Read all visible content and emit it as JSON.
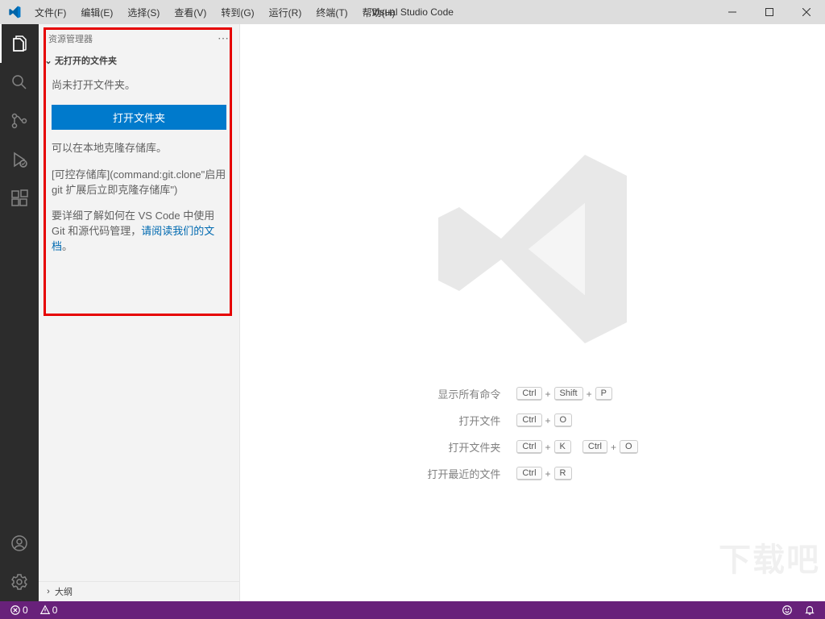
{
  "titlebar": {
    "title": "Visual Studio Code"
  },
  "menu": {
    "file": "文件(F)",
    "edit": "编辑(E)",
    "select": "选择(S)",
    "view": "查看(V)",
    "go": "转到(G)",
    "run": "运行(R)",
    "terminal": "终端(T)",
    "help": "帮助(H)"
  },
  "sidebar": {
    "header": "资源管理器",
    "no_folder_title": "无打开的文件夹",
    "not_open_msg": "尚未打开文件夹。",
    "open_folder_btn": "打开文件夹",
    "clone_msg": "可以在本地克隆存储库。",
    "clone_cmd": "[可控存储库](command:git.clone\"启用 git 扩展后立即克隆存储库\")",
    "git_help_prefix": "要详细了解如何在 VS Code 中使用 Git 和源代码管理，",
    "git_help_link": "请阅读我们的文档",
    "git_help_suffix": "。",
    "outline": "大纲"
  },
  "editor": {
    "show_all": "显示所有命令",
    "open_file": "打开文件",
    "open_folder": "打开文件夹",
    "open_recent": "打开最近的文件",
    "keys": {
      "ctrl": "Ctrl",
      "shift": "Shift",
      "p": "P",
      "o": "O",
      "k": "K",
      "r": "R"
    }
  },
  "statusbar": {
    "errors": "0",
    "warnings": "0"
  }
}
